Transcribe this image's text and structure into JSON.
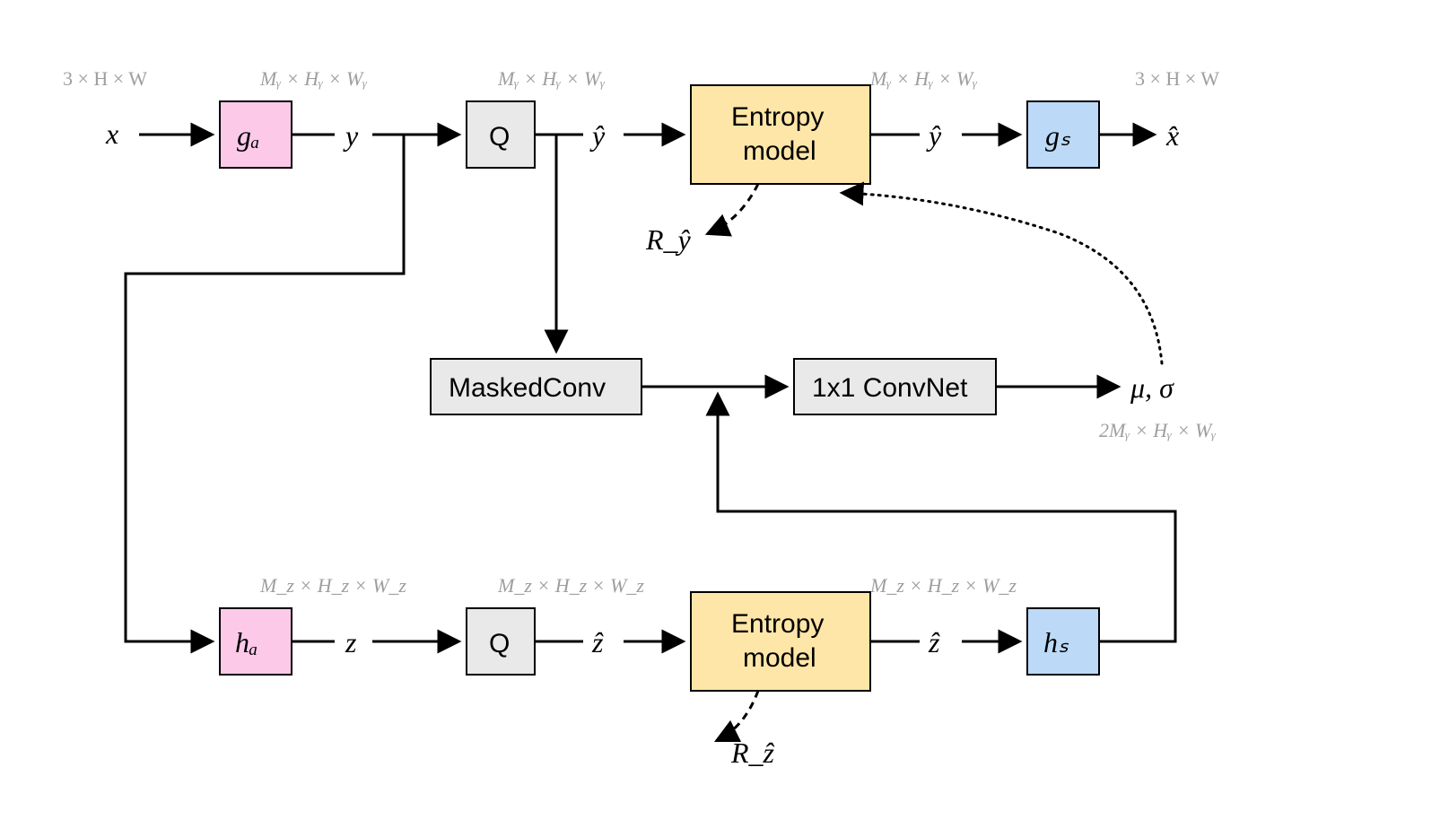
{
  "dims": {
    "x": "3 × H × W",
    "y": "Mᵧ × Hᵧ × Wᵧ",
    "yhat": "Mᵧ × Hᵧ × Wᵧ",
    "yhat_out": "Mᵧ × Hᵧ × Wᵧ",
    "xhat": "3 × H × W",
    "z": "M_z × H_z × W_z",
    "zhat": "M_z × H_z × W_z",
    "zhat_out": "M_z × H_z × W_z",
    "musigma": "2Mᵧ × Hᵧ × Wᵧ"
  },
  "vars": {
    "x": "x",
    "y": "y",
    "yhat": "ŷ",
    "yhat_out": "ŷ",
    "xhat": "x̂",
    "z": "z",
    "zhat": "ẑ",
    "zhat_out": "ẑ",
    "musigma": "μ, σ",
    "Ry": "R_ŷ",
    "Rz": "R_ẑ"
  },
  "blocks": {
    "ga": "gₐ",
    "gs": "gₛ",
    "ha": "hₐ",
    "hs": "hₛ",
    "Q": "Q",
    "entropy_line1": "Entropy",
    "entropy_line2": "model",
    "masked": "MaskedConv",
    "convnet": "1x1 ConvNet"
  }
}
